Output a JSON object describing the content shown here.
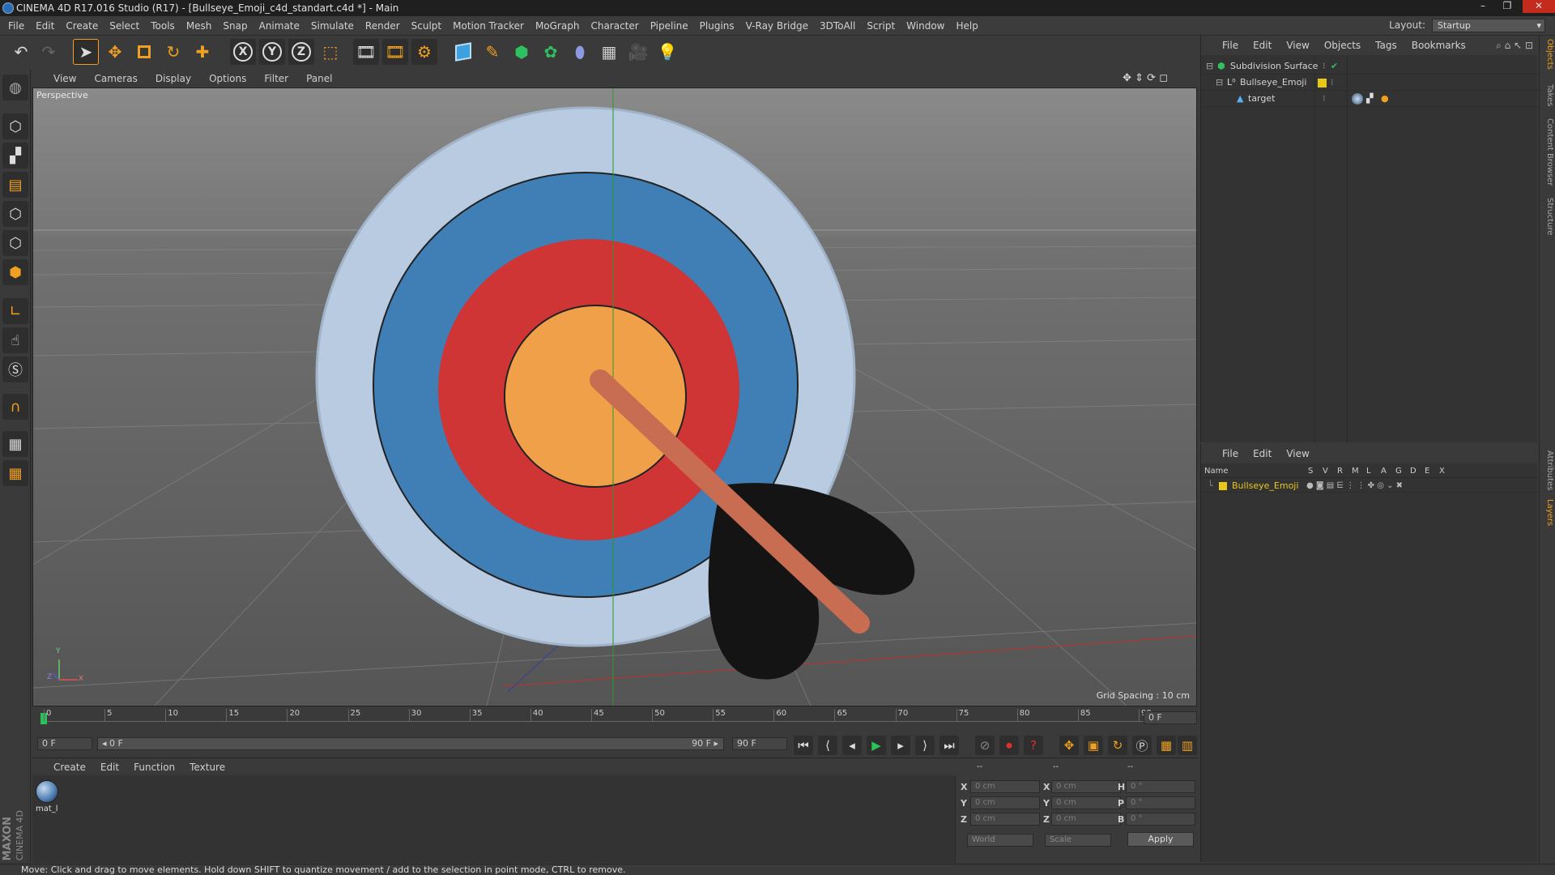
{
  "window": {
    "title": "CINEMA 4D R17.016 Studio (R17) - [Bullseye_Emoji_c4d_standart.c4d *] - Main",
    "controls": [
      "–",
      "❐",
      "✕"
    ]
  },
  "menu": [
    "File",
    "Edit",
    "Create",
    "Select",
    "Tools",
    "Mesh",
    "Snap",
    "Animate",
    "Simulate",
    "Render",
    "Sculpt",
    "Motion Tracker",
    "MoGraph",
    "Character",
    "Pipeline",
    "Plugins",
    "V-Ray Bridge",
    "3DToAll",
    "Script",
    "Window",
    "Help"
  ],
  "layout": {
    "label": "Layout:",
    "value": "Startup"
  },
  "toolbar": {
    "axis_x": "X",
    "axis_y": "Y",
    "axis_z": "Z"
  },
  "viewport": {
    "menu": [
      "View",
      "Cameras",
      "Display",
      "Options",
      "Filter",
      "Panel"
    ],
    "label": "Perspective",
    "grid_spacing": "Grid Spacing : 10 cm",
    "axis_y": "Y",
    "axis_x": "X",
    "axis_z": "Z"
  },
  "timeline": {
    "ticks": [
      "0",
      "5",
      "10",
      "15",
      "20",
      "25",
      "30",
      "35",
      "40",
      "45",
      "50",
      "55",
      "60",
      "65",
      "70",
      "75",
      "80",
      "85",
      "90"
    ],
    "current_frame": "0 F"
  },
  "transport": {
    "start_field": "0 F",
    "range_start": "◂ 0 F",
    "range_end": "90 F ▸",
    "end_field": "90 F"
  },
  "material_manager": {
    "menu": [
      "Create",
      "Edit",
      "Function",
      "Texture"
    ],
    "material_name": "mat_l"
  },
  "coordinates": {
    "col_headers": [
      "--",
      "--",
      "--"
    ],
    "rows": [
      {
        "a": "X",
        "av": "0 cm",
        "b": "X",
        "bv": "0 cm",
        "c": "H",
        "cv": "0 °"
      },
      {
        "a": "Y",
        "av": "0 cm",
        "b": "Y",
        "bv": "0 cm",
        "c": "P",
        "cv": "0 °"
      },
      {
        "a": "Z",
        "av": "0 cm",
        "b": "Z",
        "bv": "0 cm",
        "c": "B",
        "cv": "0 °"
      }
    ],
    "mode": "World",
    "type": "Scale",
    "apply": "Apply"
  },
  "object_manager": {
    "menu": [
      "File",
      "Edit",
      "View",
      "Objects",
      "Tags",
      "Bookmarks"
    ],
    "objects": [
      {
        "name": "Subdivision Surface",
        "indent": 0
      },
      {
        "name": "Bullseye_Emoji",
        "indent": 1
      },
      {
        "name": "target",
        "indent": 2
      }
    ]
  },
  "layer_manager": {
    "menu": [
      "File",
      "Edit",
      "View"
    ],
    "columns": [
      "Name",
      "S",
      "V",
      "R",
      "M",
      "L",
      "A",
      "G",
      "D",
      "E",
      "X"
    ],
    "layers": [
      {
        "name": "Bullseye_Emoji",
        "color": "#e8c81a"
      }
    ]
  },
  "right_tabs_top": [
    "Objects",
    "Takes",
    "Content Browser",
    "Structure"
  ],
  "right_tabs_bottom": [
    "Attributes",
    "Layers"
  ],
  "branding": {
    "line1": "MAXON",
    "line2": "CINEMA 4D"
  },
  "status": "Move: Click and drag to move elements. Hold down SHIFT to quantize movement / add to the selection in point mode, CTRL to remove.",
  "colors": {
    "accent_orange": "#f0a020",
    "target_outer": "#b8cbe0",
    "target_blue": "#3f7fb5",
    "target_red": "#cf3535",
    "target_center": "#f0a048",
    "arrow_shaft": "#c86c52",
    "fletching": "#141414"
  }
}
